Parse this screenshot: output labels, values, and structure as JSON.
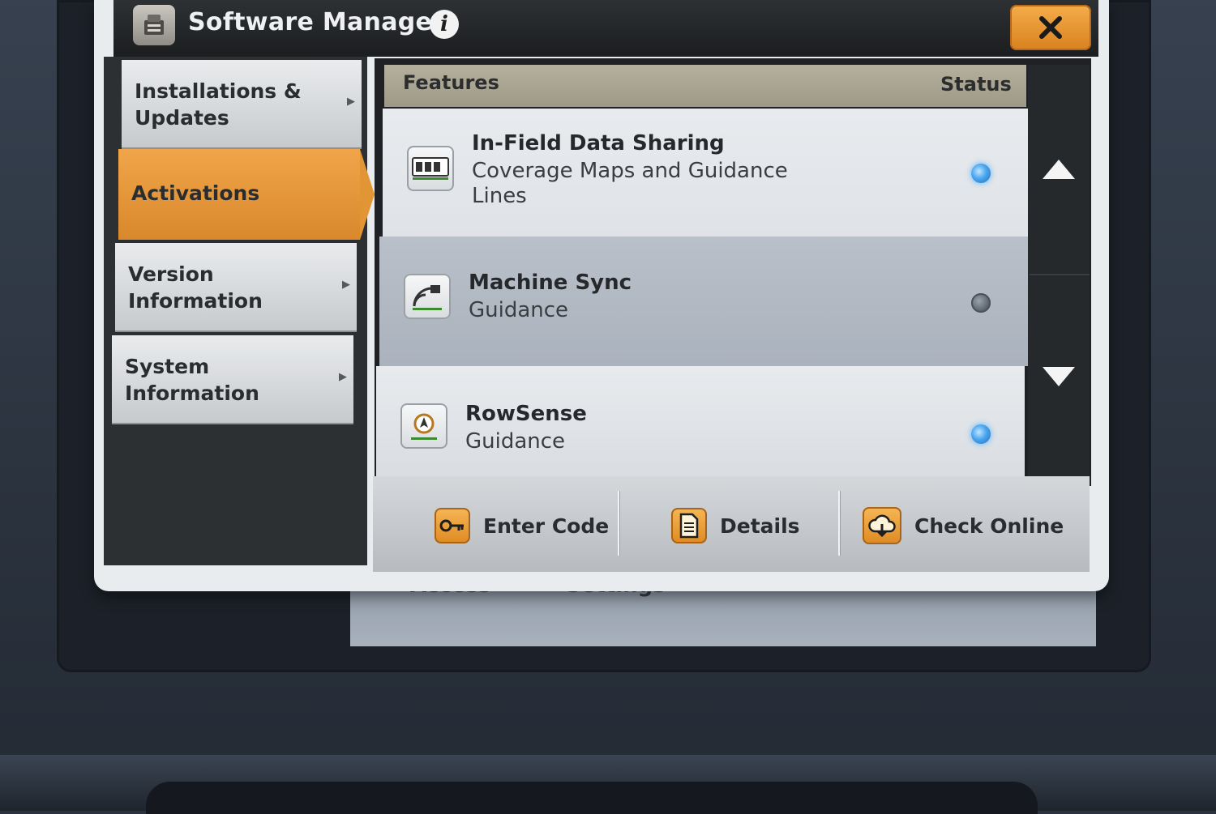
{
  "window": {
    "title": "Software Manager",
    "close_label": "✕"
  },
  "nav": {
    "items": [
      {
        "label": "Installations &\nUpdates",
        "active": false
      },
      {
        "label": "Activations",
        "active": true
      },
      {
        "label": "Version\nInformation",
        "active": false
      },
      {
        "label": "System\nInformation",
        "active": false
      }
    ]
  },
  "list": {
    "header_features": "Features",
    "header_status": "Status",
    "rows": [
      {
        "name": "In-Field Data Sharing",
        "description": "Coverage Maps and Guidance\nLines",
        "status": "on",
        "icon": "data-sharing-icon"
      },
      {
        "name": "Machine Sync",
        "description": "Guidance",
        "status": "off",
        "icon": "machine-sync-icon"
      },
      {
        "name": "RowSense",
        "description": "Guidance",
        "status": "on",
        "icon": "rowsense-icon"
      }
    ]
  },
  "actions": {
    "enter_code": "Enter Code",
    "details": "Details",
    "check_online": "Check Online"
  },
  "background_screen": {
    "label_1": "Access",
    "label_2": "Settings"
  },
  "colors": {
    "accent_orange": "#e29535",
    "status_on": "#4aa6ef",
    "status_off": "#5c656e"
  }
}
